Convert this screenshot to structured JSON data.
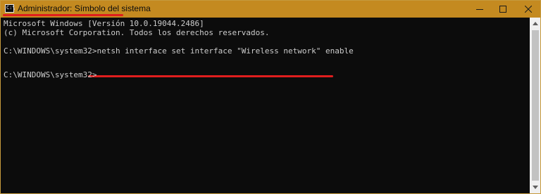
{
  "window": {
    "title": "Administrador: Símbolo del sistema",
    "icon": "cmd-app-icon",
    "icon_glyph": "C:\\",
    "titlebar_color": "#c48a20",
    "highlight_color": "#e01e1e"
  },
  "caption_buttons": {
    "minimize": "minimize-icon",
    "maximize": "maximize-icon",
    "close": "close-icon"
  },
  "console": {
    "background": "#0c0c0c",
    "foreground": "#cccccc",
    "lines": [
      "Microsoft Windows [Versión 10.0.19044.2486]",
      "(c) Microsoft Corporation. Todos los derechos reservados.",
      "C:\\WINDOWS\\system32>netsh interface set interface \"Wireless network\" enable",
      "C:\\WINDOWS\\system32>"
    ]
  },
  "scrollbar": {
    "up_icon": "scroll-up-arrow-icon",
    "down_icon": "scroll-down-arrow-icon"
  }
}
